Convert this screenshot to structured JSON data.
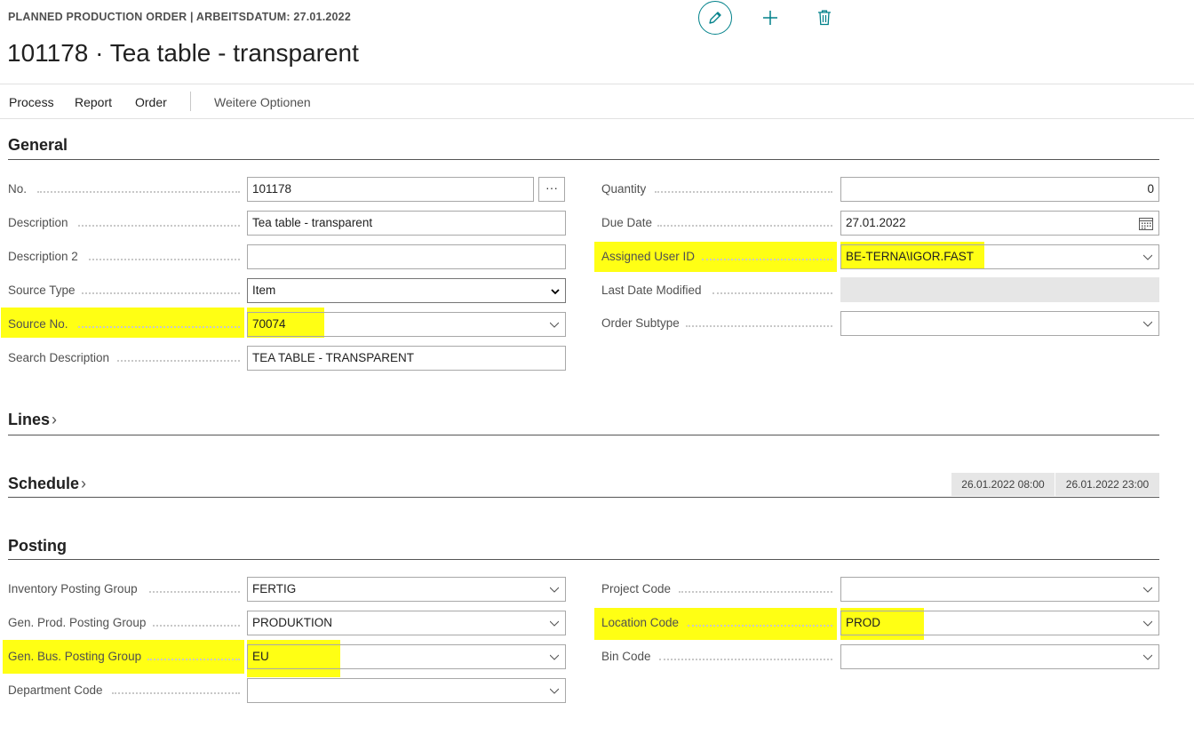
{
  "header": {
    "caption": "PLANNED PRODUCTION ORDER | ARBEITSDATUM: 27.01.2022",
    "title": "101178 · Tea table - transparent",
    "accent_color": "#00818a"
  },
  "actions": {
    "edit_icon": "pencil-icon",
    "new_icon": "plus-icon",
    "delete_icon": "trash-icon"
  },
  "menu": {
    "process": "Process",
    "report": "Report",
    "order": "Order",
    "more": "Weitere Optionen"
  },
  "general": {
    "title": "General",
    "no_label": "No.",
    "no_value": "101178",
    "ellipsis": "···",
    "description_label": "Description",
    "description_value": "Tea table - transparent",
    "description2_label": "Description 2",
    "description2_value": "",
    "source_type_label": "Source Type",
    "source_type_value": "Item",
    "source_no_label": "Source No.",
    "source_no_value": "70074",
    "search_description_label": "Search Description",
    "search_description_value": "TEA TABLE - TRANSPARENT",
    "quantity_label": "Quantity",
    "quantity_value": "0",
    "due_date_label": "Due Date",
    "due_date_value": "27.01.2022",
    "assigned_user_label": "Assigned User ID",
    "assigned_user_value": "BE-TERNA\\IGOR.FAST",
    "last_date_modified_label": "Last Date Modified",
    "last_date_modified_value": "",
    "order_subtype_label": "Order Subtype",
    "order_subtype_value": ""
  },
  "lines": {
    "title": "Lines"
  },
  "schedule": {
    "title": "Schedule",
    "start": "26.01.2022 08:00",
    "end": "26.01.2022 23:00"
  },
  "posting": {
    "title": "Posting",
    "inventory_posting_group_label": "Inventory Posting Group",
    "inventory_posting_group_value": "FERTIG",
    "gen_prod_posting_group_label": "Gen. Prod. Posting Group",
    "gen_prod_posting_group_value": "PRODUKTION",
    "gen_bus_posting_group_label": "Gen. Bus. Posting Group",
    "gen_bus_posting_group_value": "EU",
    "department_code_label": "Department Code",
    "department_code_value": "",
    "project_code_label": "Project Code",
    "project_code_value": "",
    "location_code_label": "Location Code",
    "location_code_value": "PROD",
    "bin_code_label": "Bin Code",
    "bin_code_value": ""
  },
  "highlight_color": "#ffff14"
}
